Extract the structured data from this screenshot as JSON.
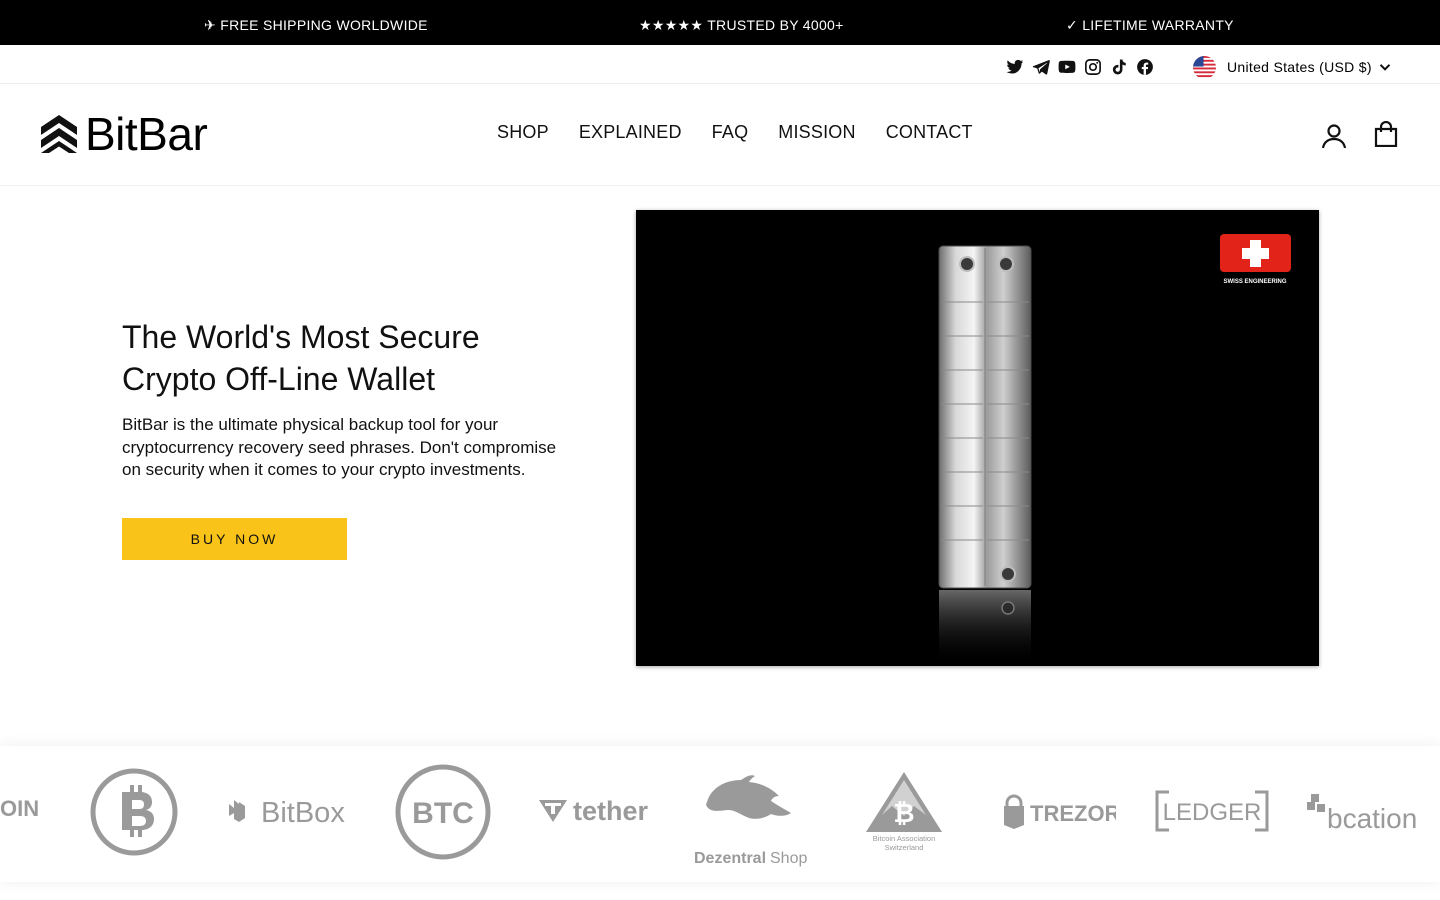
{
  "announcement": {
    "shipping": "✈ FREE SHIPPING WORLDWIDE",
    "trusted": "★★★★★ TRUSTED BY 4000+",
    "warranty": "✓ LIFETIME WARRANTY"
  },
  "social": [
    "twitter-icon",
    "telegram-icon",
    "youtube-icon",
    "instagram-icon",
    "tiktok-icon",
    "facebook-icon"
  ],
  "locale": {
    "label": "United States (USD $)"
  },
  "brand": {
    "name": "BitBar"
  },
  "nav": {
    "shop": "SHOP",
    "explained": "EXPLAINED",
    "faq": "FAQ",
    "mission": "MISSION",
    "contact": "CONTACT"
  },
  "hero": {
    "title": "The World's Most Secure Crypto Off-Line Wallet",
    "description": "BitBar is the ultimate physical backup tool for your cryptocurrency recovery seed phrases. Don't compromise on security when it comes to your crypto investments.",
    "cta": "BUY NOW",
    "badge": "SWISS ENGINEERING"
  },
  "partners": {
    "coin": "OIN",
    "bitbox": "BitBox",
    "btc": "BTC",
    "tether": "tether",
    "dezentral_main": "Dezentral",
    "dezentral_shop": "Shop",
    "bitcoin_association_1": "Bitcoin Association",
    "bitcoin_association_2": "Switzerland",
    "trezor": "TREZOR",
    "ledger": "LEDGER",
    "bcation": "bcation"
  },
  "colors": {
    "cta": "#f9c31a",
    "announcement_bg": "#000000",
    "partner_gray": "#9a9a9a"
  }
}
